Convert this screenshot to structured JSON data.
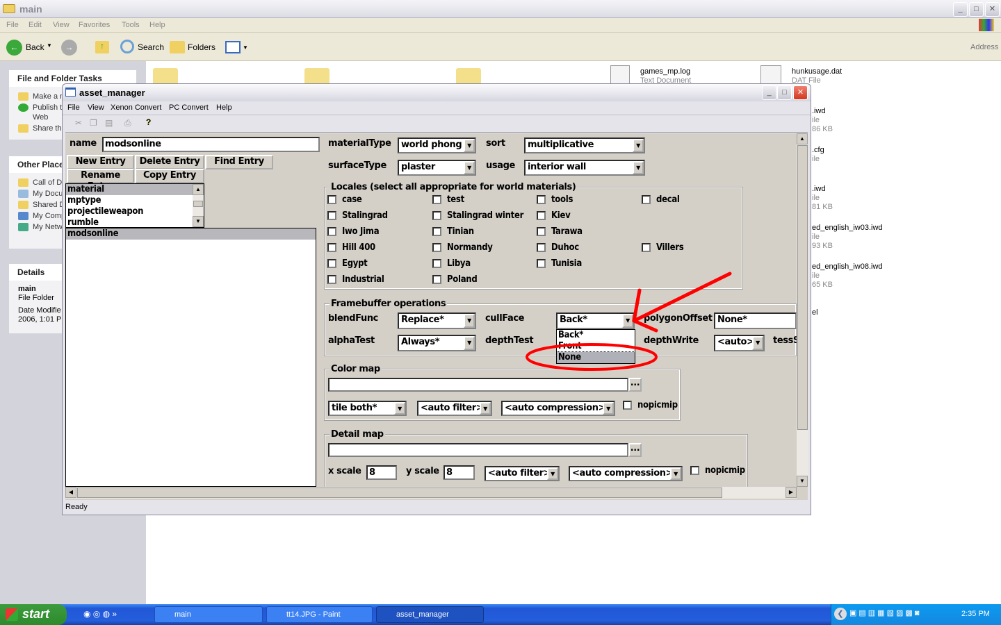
{
  "explorer": {
    "title": "main",
    "menu": [
      "File",
      "Edit",
      "View",
      "Favorites",
      "Tools",
      "Help"
    ],
    "toolbar": {
      "back": "Back",
      "search": "Search",
      "folders": "Folders",
      "address": "Address"
    },
    "tasks": {
      "header": "File and Folder Tasks",
      "items": [
        "Make a n",
        "Publish t",
        "Web",
        "Share th"
      ]
    },
    "places": {
      "header": "Other Place",
      "items": [
        "Call of D",
        "My Docu",
        "Shared D",
        "My Comp",
        "My Netw"
      ]
    },
    "details": {
      "header": "Details",
      "name": "main",
      "type": "File Folder",
      "modified1": "Date Modifie",
      "modified2": "2006, 1:01 P"
    },
    "files": [
      {
        "name": "games_mp.log",
        "sub": "Text Document"
      },
      {
        "name": "hunkusage.dat",
        "sub": "DAT File"
      }
    ],
    "right_files": [
      [
        ".iwd",
        "ile",
        "86 KB"
      ],
      [
        ".cfg",
        "ile",
        ""
      ],
      [
        ".iwd",
        "ile",
        "81 KB"
      ],
      [
        "ed_english_iw03.iwd",
        "ile",
        "93 KB"
      ],
      [
        "ed_english_iw08.iwd",
        "ile",
        "65 KB"
      ],
      [
        "el",
        "",
        ""
      ]
    ]
  },
  "am": {
    "title": "asset_manager",
    "menu": [
      "File",
      "View",
      "Xenon Convert",
      "PC Convert",
      "Help"
    ],
    "name_label": "name",
    "name_value": "modsonline",
    "buttons": {
      "new": "New Entry",
      "delete": "Delete Entry",
      "find": "Find Entry",
      "rename": "Rename Entry",
      "copy": "Copy Entry"
    },
    "types": [
      "material",
      "mptype",
      "projectileweapon",
      "rumble"
    ],
    "selected_type": "material",
    "entries": [
      "modsonline"
    ],
    "fields": {
      "materialType": {
        "label": "materialType",
        "value": "world phong"
      },
      "sort": {
        "label": "sort",
        "value": "multiplicative"
      },
      "surfaceType": {
        "label": "surfaceType",
        "value": "plaster"
      },
      "usage": {
        "label": "usage",
        "value": "interior wall"
      }
    },
    "locales": {
      "title": "Locales (select all appropriate for world materials)",
      "rows": [
        [
          "case",
          "test",
          "tools",
          "decal"
        ],
        [
          "Stalingrad",
          "Stalingrad winter",
          "Kiev",
          ""
        ],
        [
          "Iwo Jima",
          "Tinian",
          "Tarawa",
          ""
        ],
        [
          "Hill 400",
          "Normandy",
          "Duhoc",
          "Villers"
        ],
        [
          "Egypt",
          "Libya",
          "Tunisia",
          ""
        ],
        [
          "Industrial",
          "Poland",
          "",
          ""
        ]
      ]
    },
    "framebuffer": {
      "title": "Framebuffer operations",
      "blendFunc": {
        "label": "blendFunc",
        "value": "Replace*"
      },
      "cullFace": {
        "label": "cullFace",
        "value": "Back*",
        "options": [
          "Back*",
          "Front",
          "None"
        ],
        "highlighted": "None"
      },
      "polygonOffset": {
        "label": "polygonOffset",
        "value": "None*"
      },
      "alphaTest": {
        "label": "alphaTest",
        "value": "Always*"
      },
      "depthTest": {
        "label": "depthTest"
      },
      "depthWrite": {
        "label": "depthWrite",
        "value": "<auto>*"
      },
      "tess": {
        "label": "tessS"
      }
    },
    "colormap": {
      "title": "Color map",
      "path": "",
      "browse": "...",
      "tile": "tile both*",
      "filter": "<auto filter>*",
      "compression": "<auto compression>*",
      "nopicmip": "nopicmip"
    },
    "detailmap": {
      "title": "Detail map",
      "path": "",
      "browse": "...",
      "xscale_label": "x scale",
      "xscale": "8",
      "yscale_label": "y scale",
      "yscale": "8",
      "filter": "<auto filter>*",
      "compression": "<auto compression>*",
      "nopicmip": "nopicmip"
    },
    "status": "Ready"
  },
  "annotation_color": "#ff0000",
  "taskbar": {
    "start": "start",
    "tasks": [
      "main",
      "tt14.JPG - Paint",
      "asset_manager"
    ],
    "active": "asset_manager",
    "clock": "2:35 PM"
  }
}
